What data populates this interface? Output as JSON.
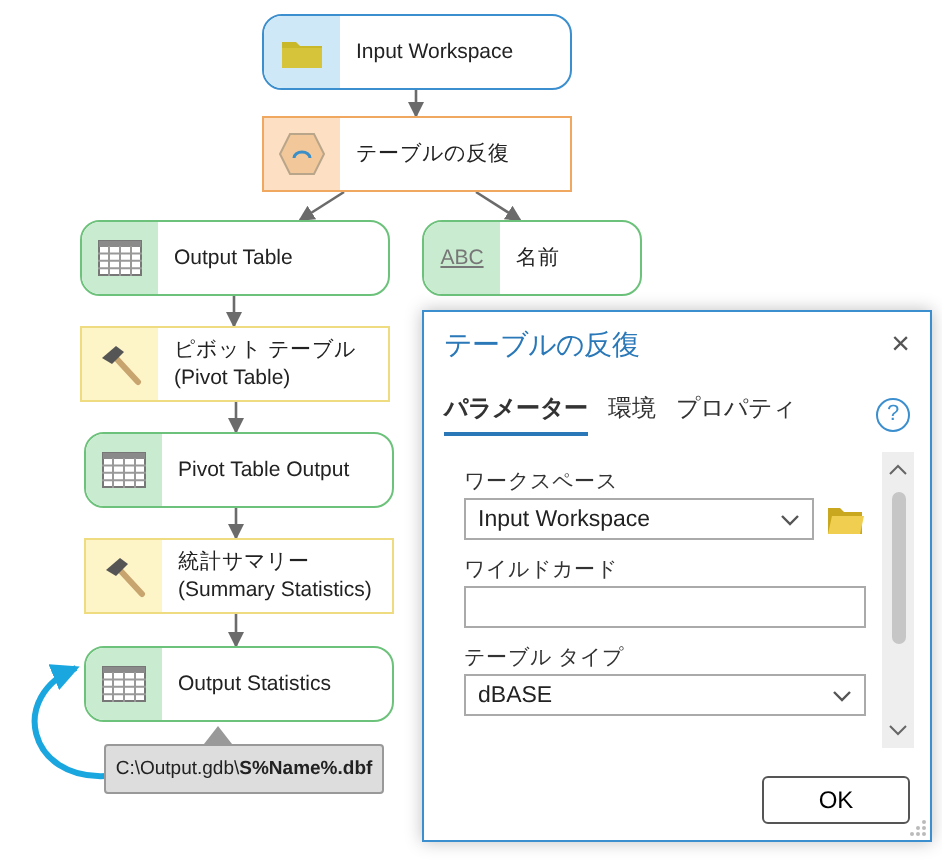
{
  "diagram": {
    "nodes": [
      {
        "kind": "input",
        "label": "Input Workspace"
      },
      {
        "kind": "iterator",
        "label": "テーブルの反復"
      },
      {
        "kind": "data",
        "label": "Output Table"
      },
      {
        "kind": "variable",
        "label": "名前",
        "badge": "ABC"
      },
      {
        "kind": "tool",
        "label": "ピボット テーブル (Pivot Table)"
      },
      {
        "kind": "data",
        "label": "Pivot Table Output"
      },
      {
        "kind": "tool",
        "label": "統計サマリー (Summary Statistics)"
      },
      {
        "kind": "data",
        "label": "Output Statistics"
      }
    ],
    "callout": "C:\\Output.gdb\\**S%Name%.dbf**"
  },
  "dialog": {
    "title": "テーブルの反復",
    "close": "×",
    "help": "?",
    "tabs": [
      {
        "label": "パラメーター",
        "selected": true
      },
      {
        "label": "環境",
        "selected": false
      },
      {
        "label": "プロパティ",
        "selected": false
      }
    ],
    "fields": [
      {
        "kind": "dropdown",
        "label": "ワークスペース",
        "value": "Input Workspace",
        "browse": true
      },
      {
        "kind": "text",
        "label": "ワイルドカード"
      },
      {
        "kind": "dropdown",
        "label": "テーブル タイプ",
        "value": "dBASE"
      }
    ],
    "buttons": [
      "OK"
    ]
  }
}
